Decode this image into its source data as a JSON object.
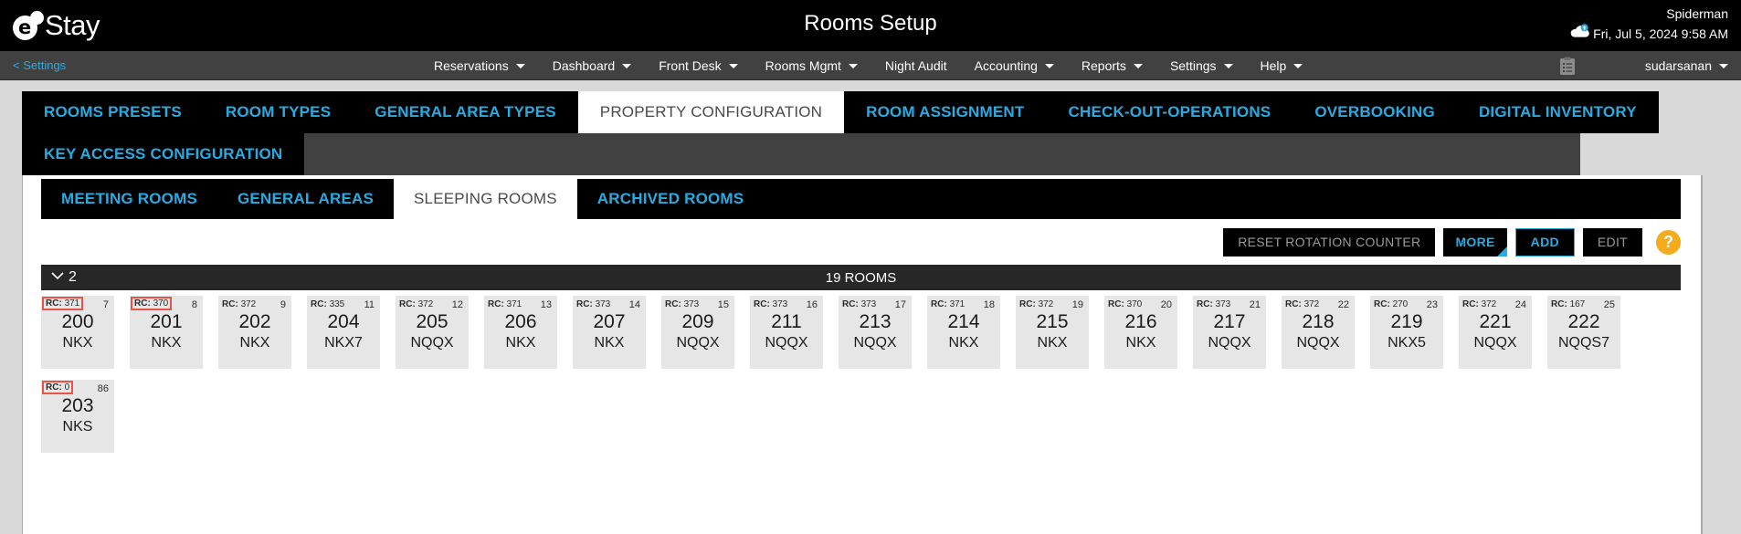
{
  "brand": {
    "logo_glyph": "e",
    "logo_text": "Stay"
  },
  "header": {
    "title": "Rooms Setup",
    "user_name": "Spiderman",
    "datetime": "Fri, Jul 5, 2024 9:58 AM",
    "cloud_icon": "cloud-sync-icon"
  },
  "nav": {
    "back_label": "< Settings",
    "items": [
      {
        "label": "Reservations",
        "caret": true
      },
      {
        "label": "Dashboard",
        "caret": true
      },
      {
        "label": "Front Desk",
        "caret": true
      },
      {
        "label": "Rooms Mgmt",
        "caret": true
      },
      {
        "label": "Night Audit",
        "caret": false
      },
      {
        "label": "Accounting",
        "caret": true
      },
      {
        "label": "Reports",
        "caret": true
      },
      {
        "label": "Settings",
        "caret": true
      },
      {
        "label": "Help",
        "caret": true
      }
    ],
    "clipboard_icon": "clipboard-icon",
    "account_label": "sudarsanan"
  },
  "main_tabs_row1": [
    {
      "label": "ROOMS PRESETS",
      "active": false
    },
    {
      "label": "ROOM TYPES",
      "active": false
    },
    {
      "label": "GENERAL AREA TYPES",
      "active": false
    },
    {
      "label": "PROPERTY CONFIGURATION",
      "active": true
    },
    {
      "label": "ROOM ASSIGNMENT",
      "active": false
    },
    {
      "label": "CHECK-OUT-OPERATIONS",
      "active": false
    },
    {
      "label": "OVERBOOKING",
      "active": false
    },
    {
      "label": "DIGITAL INVENTORY",
      "active": false
    }
  ],
  "main_tabs_row2": [
    {
      "label": "KEY ACCESS CONFIGURATION",
      "active": false
    }
  ],
  "sub_tabs": [
    {
      "label": "MEETING ROOMS",
      "active": false
    },
    {
      "label": "GENERAL AREAS",
      "active": false
    },
    {
      "label": "SLEEPING ROOMS",
      "active": true
    },
    {
      "label": "ARCHIVED ROOMS",
      "active": false
    }
  ],
  "actions": {
    "reset_label": "RESET ROTATION COUNTER",
    "more_label": "MORE",
    "add_label": "ADD",
    "edit_label": "EDIT",
    "help_label": "?"
  },
  "group": {
    "label": "2",
    "count_label": "19 ROOMS",
    "chevron_icon": "chevron-down-icon"
  },
  "colors": {
    "accent_cyan": "#29abe2",
    "flag_red": "#e8534a",
    "help_orange": "#f4ab1c",
    "card_grey": "#e6e6e6",
    "header_black": "#000000",
    "group_header": "#272727"
  },
  "rooms": [
    {
      "rc_prefix": "RC:",
      "rc_value": "371",
      "seq": "7",
      "number": "200",
      "type": "NKX",
      "flagged": true
    },
    {
      "rc_prefix": "RC:",
      "rc_value": "370",
      "seq": "8",
      "number": "201",
      "type": "NKX",
      "flagged": true
    },
    {
      "rc_prefix": "RC:",
      "rc_value": "372",
      "seq": "9",
      "number": "202",
      "type": "NKX",
      "flagged": false
    },
    {
      "rc_prefix": "RC:",
      "rc_value": "335",
      "seq": "11",
      "number": "204",
      "type": "NKX7",
      "flagged": false
    },
    {
      "rc_prefix": "RC:",
      "rc_value": "372",
      "seq": "12",
      "number": "205",
      "type": "NQQX",
      "flagged": false
    },
    {
      "rc_prefix": "RC:",
      "rc_value": "371",
      "seq": "13",
      "number": "206",
      "type": "NKX",
      "flagged": false
    },
    {
      "rc_prefix": "RC:",
      "rc_value": "373",
      "seq": "14",
      "number": "207",
      "type": "NKX",
      "flagged": false
    },
    {
      "rc_prefix": "RC:",
      "rc_value": "373",
      "seq": "15",
      "number": "209",
      "type": "NQQX",
      "flagged": false
    },
    {
      "rc_prefix": "RC:",
      "rc_value": "373",
      "seq": "16",
      "number": "211",
      "type": "NQQX",
      "flagged": false
    },
    {
      "rc_prefix": "RC:",
      "rc_value": "373",
      "seq": "17",
      "number": "213",
      "type": "NQQX",
      "flagged": false
    },
    {
      "rc_prefix": "RC:",
      "rc_value": "371",
      "seq": "18",
      "number": "214",
      "type": "NKX",
      "flagged": false
    },
    {
      "rc_prefix": "RC:",
      "rc_value": "372",
      "seq": "19",
      "number": "215",
      "type": "NKX",
      "flagged": false
    },
    {
      "rc_prefix": "RC:",
      "rc_value": "370",
      "seq": "20",
      "number": "216",
      "type": "NKX",
      "flagged": false
    },
    {
      "rc_prefix": "RC:",
      "rc_value": "373",
      "seq": "21",
      "number": "217",
      "type": "NQQX",
      "flagged": false
    },
    {
      "rc_prefix": "RC:",
      "rc_value": "372",
      "seq": "22",
      "number": "218",
      "type": "NQQX",
      "flagged": false
    },
    {
      "rc_prefix": "RC:",
      "rc_value": "270",
      "seq": "23",
      "number": "219",
      "type": "NKX5",
      "flagged": false
    },
    {
      "rc_prefix": "RC:",
      "rc_value": "372",
      "seq": "24",
      "number": "221",
      "type": "NQQX",
      "flagged": false
    },
    {
      "rc_prefix": "RC:",
      "rc_value": "167",
      "seq": "25",
      "number": "222",
      "type": "NQQS7",
      "flagged": false
    },
    {
      "rc_prefix": "RC:",
      "rc_value": "0",
      "seq": "86",
      "number": "203",
      "type": "NKS",
      "flagged": true
    }
  ]
}
